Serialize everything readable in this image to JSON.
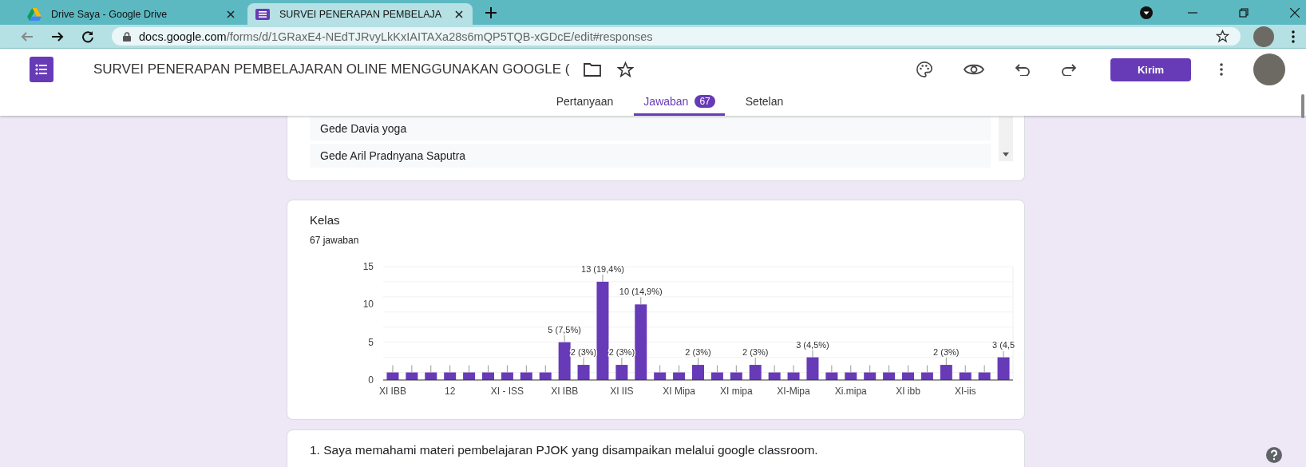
{
  "browser": {
    "tabs": [
      {
        "title": "Drive Saya - Google Drive",
        "selected": false
      },
      {
        "title": "SURVEI PENERAPAN PEMBELAJA",
        "selected": true
      }
    ],
    "url": {
      "host": "docs.google.com",
      "path": "/forms/d/1GRaxE4-NEdTJRvyLkKxIAITAXa28s6mQP5TQB-xGDcE/edit#responses"
    }
  },
  "form_header": {
    "title": "SURVEI PENERAPAN PEMBELAJARAN OLINE MENGGUNAKAN GOOGLE (",
    "send_button": "Kirim",
    "tabs": [
      {
        "label": "Pertanyaan",
        "selected": false
      },
      {
        "label": "Jawaban",
        "selected": true,
        "badge": "67"
      },
      {
        "label": "Setelan",
        "selected": false
      }
    ]
  },
  "responses_list": {
    "items": [
      "Gede Davia yoga",
      "Gede Aril Pradnyana Saputra"
    ]
  },
  "question_card": {
    "title": "Kelas",
    "count": "67 jawaban",
    "chart_data": {
      "type": "bar",
      "values": [
        1,
        1,
        1,
        1,
        1,
        1,
        1,
        1,
        1,
        5,
        2,
        13,
        2,
        10,
        1,
        1,
        2,
        1,
        1,
        2,
        1,
        1,
        3,
        1,
        1,
        1,
        1,
        1,
        1,
        2,
        1,
        1,
        3
      ],
      "ylim": [
        0,
        15
      ],
      "yticks": [
        0,
        5,
        10,
        15
      ],
      "categories": [
        "XI IBB",
        null,
        null,
        "12",
        null,
        null,
        "XI - ISS",
        null,
        null,
        "XI IBB",
        null,
        null,
        "XI IIS",
        null,
        null,
        "XI Mipa",
        null,
        null,
        "XI mipa",
        null,
        null,
        "XI-Mipa",
        null,
        null,
        "Xi.mipa",
        null,
        null,
        "XI ibb",
        null,
        null,
        "XI-iis",
        null,
        null
      ],
      "value_labels": [
        null,
        null,
        null,
        null,
        null,
        null,
        null,
        null,
        null,
        "5 (7,5%)",
        "2 (3%)",
        "13 (19,4%)",
        "2 (3%)",
        "10 (14,9%)",
        null,
        null,
        "2 (3%)",
        null,
        null,
        "2 (3%)",
        null,
        null,
        "3 (4,5%)",
        null,
        null,
        null,
        null,
        null,
        null,
        "2 (3%)",
        null,
        null,
        "3 (4,5"
      ]
    }
  },
  "next_question": {
    "title": "1. Saya memahami materi pembelajaran PJOK yang disampaikan melalui google classroom."
  }
}
